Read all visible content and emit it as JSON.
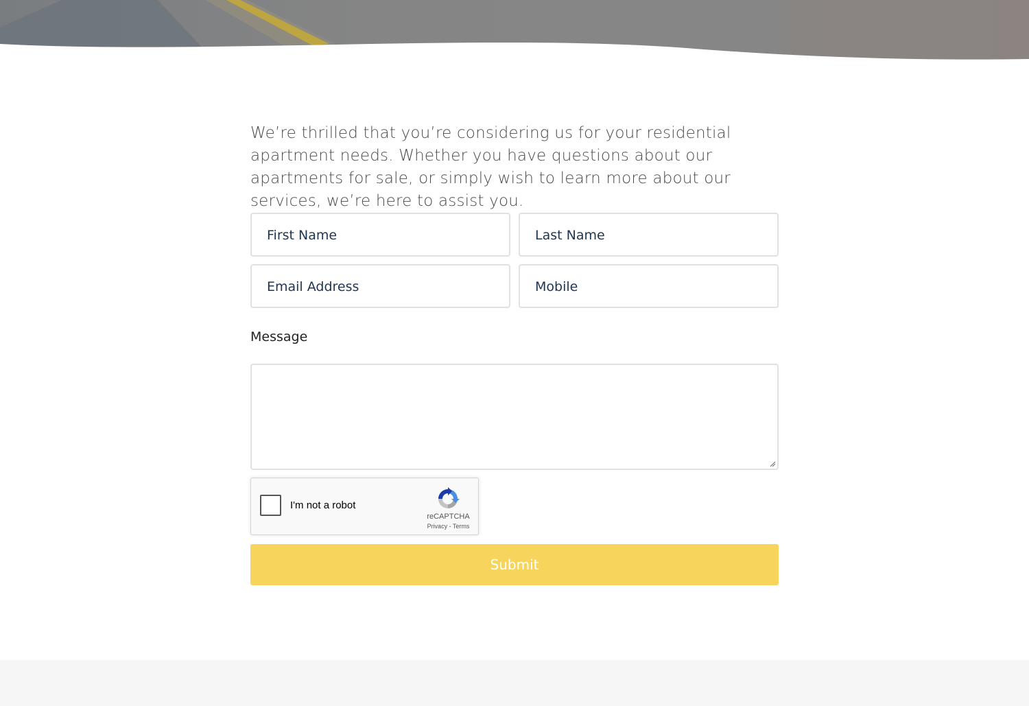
{
  "intro": {
    "text": "We’re thrilled that you’re considering us for your residential apartment needs. Whether you have questions about our apartments for sale, or simply wish to learn more about our services, we’re here to assist you."
  },
  "form": {
    "first_name_placeholder": "First Name",
    "last_name_placeholder": "Last Name",
    "email_placeholder": "Email Address",
    "mobile_placeholder": "Mobile",
    "message_label": "Message",
    "message_value": "",
    "submit_label": "Submit"
  },
  "recaptcha": {
    "label": "I'm not a robot",
    "brand": "reCAPTCHA",
    "privacy": "Privacy",
    "separator": " - ",
    "terms": "Terms",
    "checked": false
  },
  "colors": {
    "accent": "#f7d55c",
    "input_text": "#1f3550",
    "border": "#e1e1e1",
    "footer_bg": "#f6f6f6"
  },
  "icons": {
    "recaptcha": "recaptcha-logo-icon",
    "resize": "resize-grip-icon"
  }
}
